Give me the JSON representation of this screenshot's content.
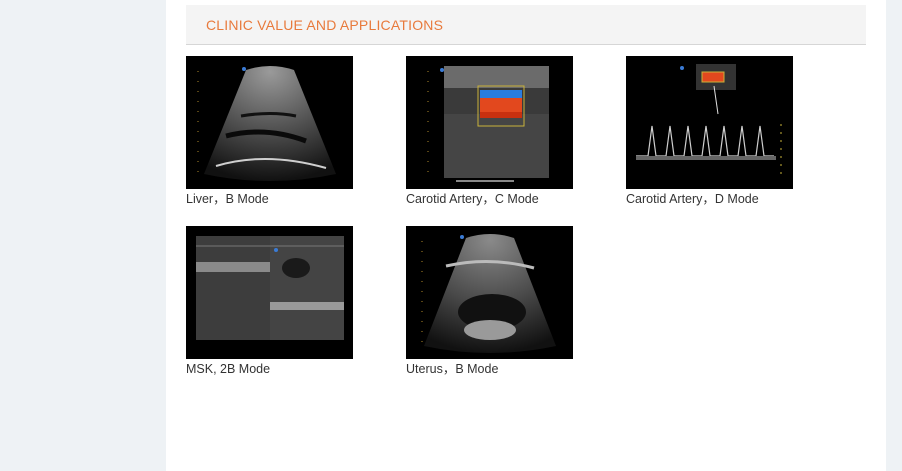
{
  "section": {
    "title": "CLINIC VALUE AND APPLICATIONS"
  },
  "gallery": [
    {
      "caption": "Liver，B Mode",
      "icon": "liver-ultrasound-image"
    },
    {
      "caption": "Carotid Artery，C Mode",
      "icon": "carotid-color-doppler-image"
    },
    {
      "caption": "Carotid Artery，D Mode",
      "icon": "carotid-spectral-doppler-image"
    },
    {
      "caption": "MSK, 2B Mode",
      "icon": "msk-dual-b-mode-image"
    },
    {
      "caption": "Uterus，B Mode",
      "icon": "uterus-ultrasound-image"
    }
  ],
  "colors": {
    "accent": "#e87a3c",
    "header_bg": "#f4f4f4",
    "page_bg": "#eef2f5"
  }
}
